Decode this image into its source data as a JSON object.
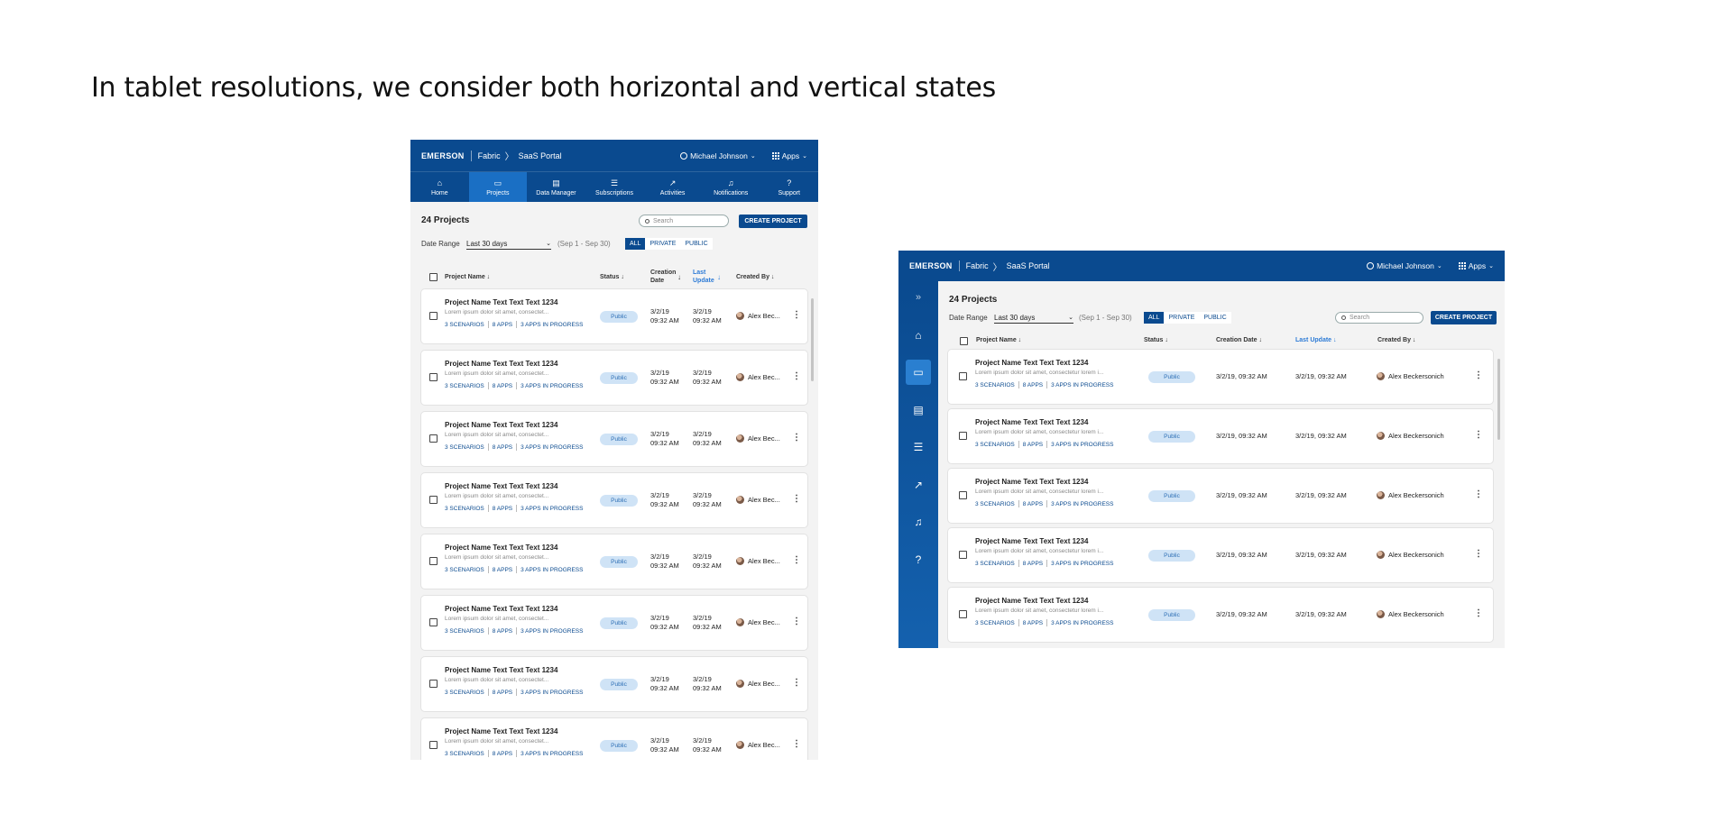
{
  "page": {
    "title": "In tablet resolutions, we consider both horizontal and vertical states"
  },
  "app": {
    "logo": "EMERSON",
    "crumbs": [
      "Fabric",
      "SaaS Portal"
    ],
    "user": "Michael Johnson",
    "apps": "Apps",
    "nav": [
      "Home",
      "Projects",
      "Data Manager",
      "Subscriptions",
      "Activities",
      "Notifications",
      "Support"
    ],
    "projects_title": "24 Projects",
    "search_placeholder": "Search",
    "create_button": "CREATE PROJECT",
    "date_range_label": "Date Range",
    "date_range_value": "Last 30 days",
    "date_range_span": "(Sep 1 - Sep 30)",
    "filters": [
      "ALL",
      "PRIVATE",
      "PUBLIC"
    ],
    "columns": {
      "name": "Project Name ↓",
      "status": "Status ↓",
      "creation_short": "Creation Date",
      "last_short": "Last Update",
      "creation_long": "Creation Date ↓",
      "last_long": "Last Update ↓",
      "created_by": "Created By ↓"
    },
    "row": {
      "name": "Project Name Text Text Text 1234",
      "desc_short": "Lorem ipsum dolor sit amet, consectet...",
      "desc_long": "Lorem ipsum dolor sit amet, consectetur lorem i...",
      "scenarios": "3 SCENARIOS",
      "apps": "8 APPS",
      "in_progress": "3 APPS IN PROGRESS",
      "status": "Public",
      "date_line1": "3/2/19",
      "date_line2": "09:32 AM",
      "date_full": "3/2/19, 09:32 AM",
      "creator_short": "Alex Bec...",
      "creator_full": "Alex Beckersonich"
    },
    "icons": {
      "nav": [
        "home-icon",
        "monitor-icon",
        "chart-icon",
        "sliders-icon",
        "trend-icon",
        "bell-icon",
        "help-icon"
      ]
    }
  }
}
